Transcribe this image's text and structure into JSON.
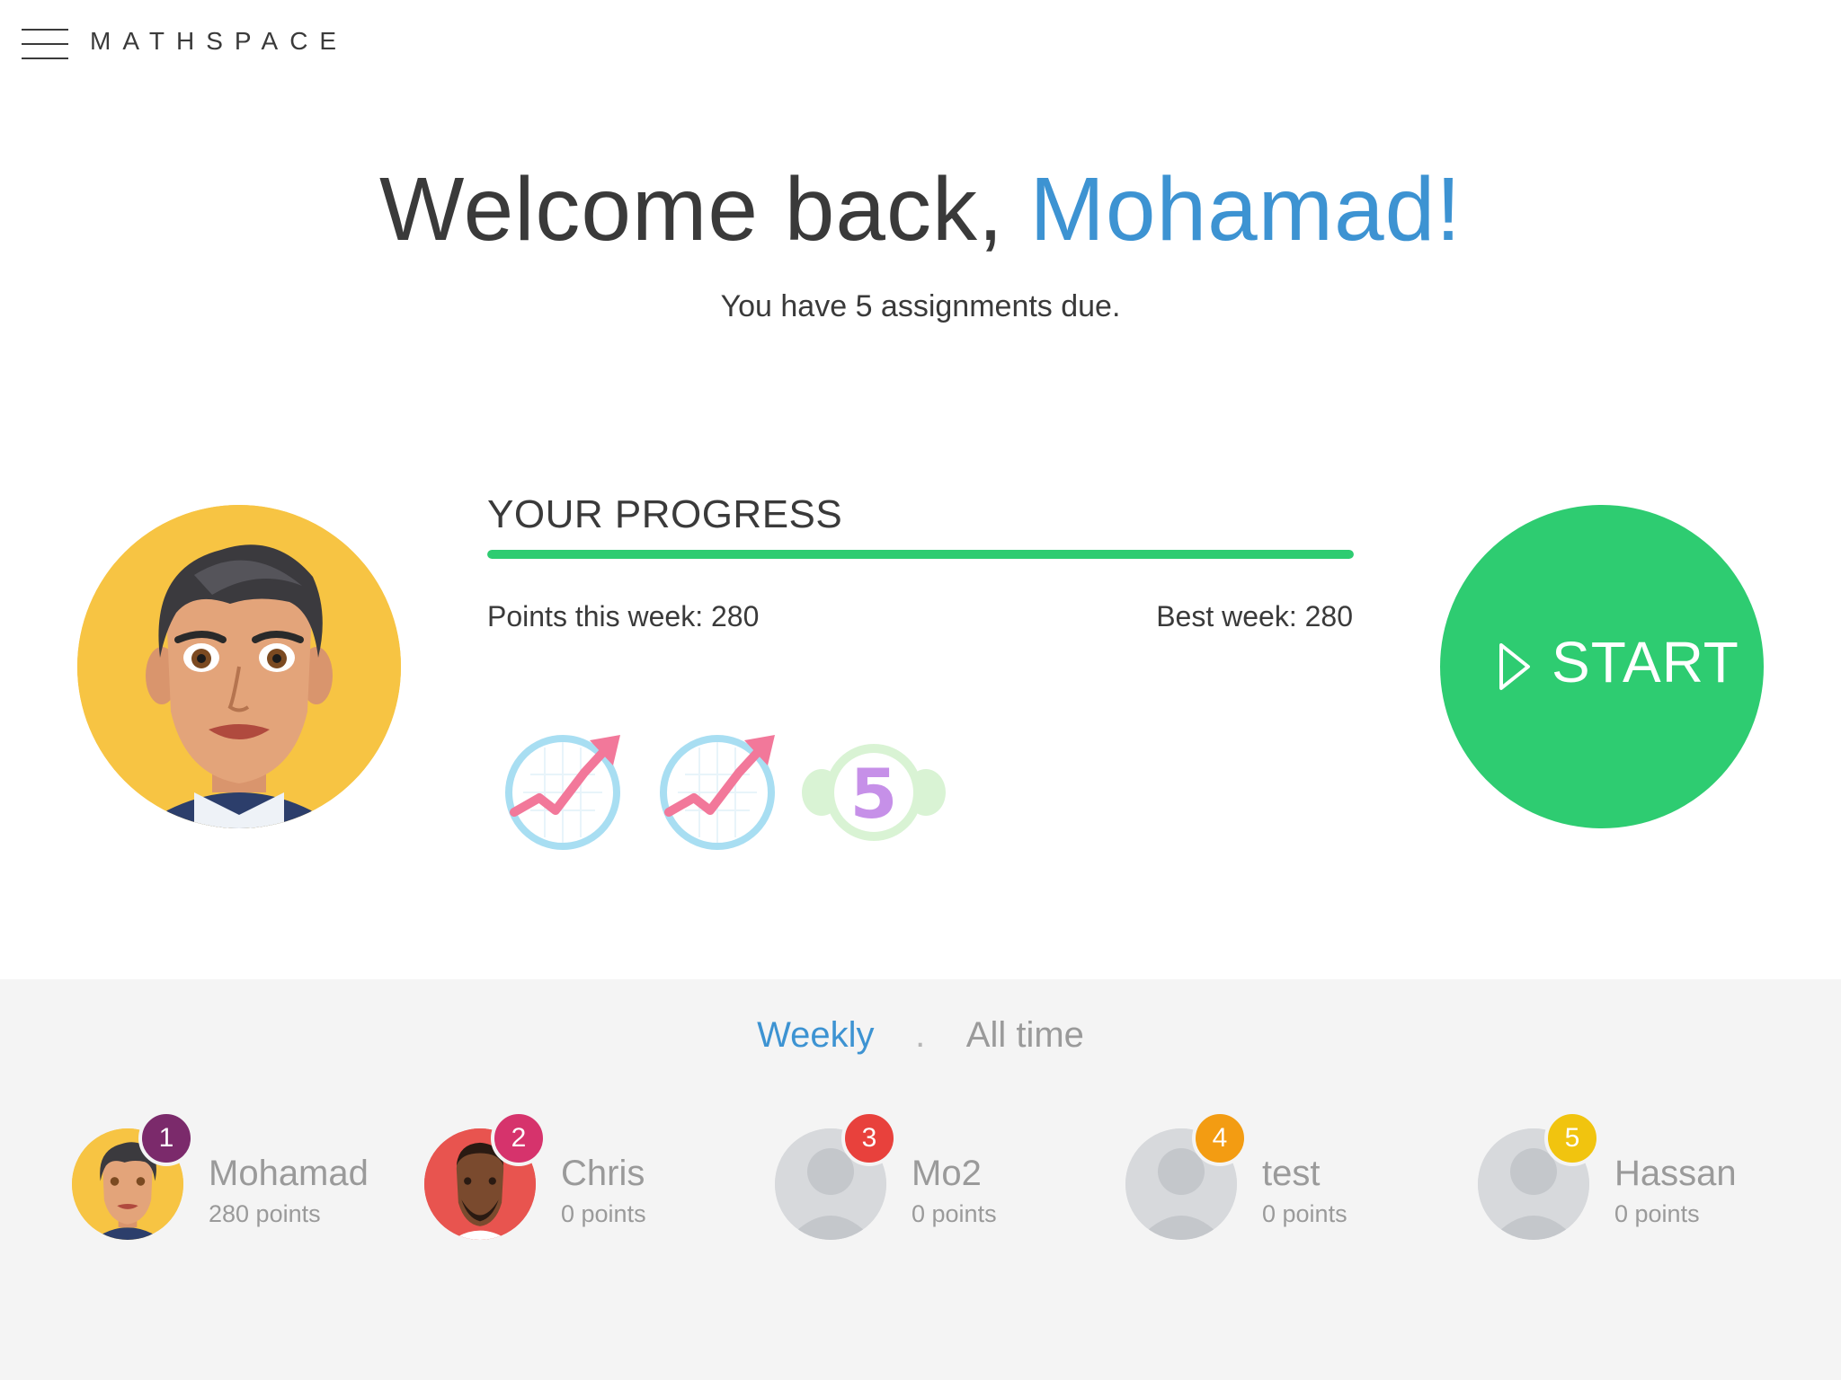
{
  "app": {
    "brand": "MATHSPACE"
  },
  "welcome": {
    "greeting": "Welcome back, ",
    "name": "Mohamad!",
    "subtitle": "You have 5 assignments due."
  },
  "progress": {
    "title": "YOUR PROGRESS",
    "fill_fraction": 1.0,
    "points_this_week": "Points this week: 280",
    "best_week": "Best week: 280",
    "badges": [
      "trend-up-badge",
      "trend-up-badge",
      "streak-5-badge"
    ],
    "streak_badge_text": "5"
  },
  "start": {
    "label": "START"
  },
  "leaderboard": {
    "tabs": [
      {
        "label": "Weekly",
        "active": true
      },
      {
        "label": "All time",
        "active": false
      }
    ],
    "separator": ".",
    "entries": [
      {
        "rank": "1",
        "name": "Mohamad",
        "points": "280 points",
        "rank_color": "#7b2a6b",
        "avatar": "boy-avatar"
      },
      {
        "rank": "2",
        "name": "Chris",
        "points": "0 points",
        "rank_color": "#d6336c",
        "avatar": "man-avatar"
      },
      {
        "rank": "3",
        "name": "Mo2",
        "points": "0 points",
        "rank_color": "#e8413c",
        "avatar": "default-avatar"
      },
      {
        "rank": "4",
        "name": "test",
        "points": "0 points",
        "rank_color": "#f39c12",
        "avatar": "default-avatar"
      },
      {
        "rank": "5",
        "name": "Hassan",
        "points": "0 points",
        "rank_color": "#f1c40f",
        "avatar": "default-avatar"
      }
    ]
  },
  "colors": {
    "accent": "#3d93d2",
    "green": "#2ecc71",
    "avatar_bg": "#f7c443"
  }
}
